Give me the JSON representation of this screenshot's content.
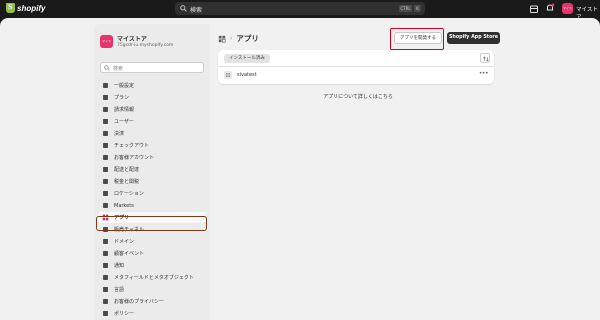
{
  "topbar": {
    "logo_text": "shopify",
    "search_placeholder": "検索",
    "kbd_ctrl": "CTRL",
    "kbd_k": "K",
    "avatar_text": "マイス",
    "store_name": "マイストア",
    "icons": [
      "store-icon",
      "bell-icon"
    ],
    "logo_color": "#95bf47",
    "avatar_color": "#e8336d"
  },
  "sidebar": {
    "store": {
      "avatar_text": "マイス",
      "name": "マイストア",
      "domain": "75gcdr-iu.myshopify.com"
    },
    "search_placeholder": "検索",
    "items": [
      {
        "label": "一般設定",
        "icon": "store-icon"
      },
      {
        "label": "プラン",
        "icon": "plan-icon"
      },
      {
        "label": "請求情報",
        "icon": "billing-icon"
      },
      {
        "label": "ユーザー",
        "icon": "user-icon"
      },
      {
        "label": "決済",
        "icon": "payment-icon"
      },
      {
        "label": "チェックアウト",
        "icon": "cart-icon"
      },
      {
        "label": "お客様アカウント",
        "icon": "account-icon"
      },
      {
        "label": "配送と配達",
        "icon": "truck-icon"
      },
      {
        "label": "税金と関税",
        "icon": "tax-icon"
      },
      {
        "label": "ロケーション",
        "icon": "location-icon"
      },
      {
        "label": "Markets",
        "icon": "globe-icon"
      },
      {
        "label": "アプリ",
        "icon": "apps-icon",
        "active": true
      },
      {
        "label": "販売チャネル",
        "icon": "channel-icon"
      },
      {
        "label": "ドメイン",
        "icon": "domain-icon"
      },
      {
        "label": "顧客イベント",
        "icon": "events-icon"
      },
      {
        "label": "通知",
        "icon": "bell-icon"
      },
      {
        "label": "メタフィールドとメタオブジェクト",
        "icon": "metafield-icon"
      },
      {
        "label": "言語",
        "icon": "language-icon"
      },
      {
        "label": "お客様のプライバシー",
        "icon": "privacy-icon"
      },
      {
        "label": "ポリシー",
        "icon": "policy-icon"
      }
    ]
  },
  "main": {
    "title": "アプリ",
    "breadcrumb_sep": "›",
    "develop_button": "アプリを開発する",
    "app_store_button": "Shopify App Store",
    "filter_chip": "インストール済み",
    "apps": [
      {
        "name": "sivatest",
        "icon": "app-icon"
      }
    ],
    "more_label": "•••",
    "learn_more": "アプリについて詳しくはこちら"
  },
  "colors": {
    "highlight_red": "#d0021b",
    "highlight_brown": "#7a3b1a",
    "primary_button": "#303030"
  }
}
